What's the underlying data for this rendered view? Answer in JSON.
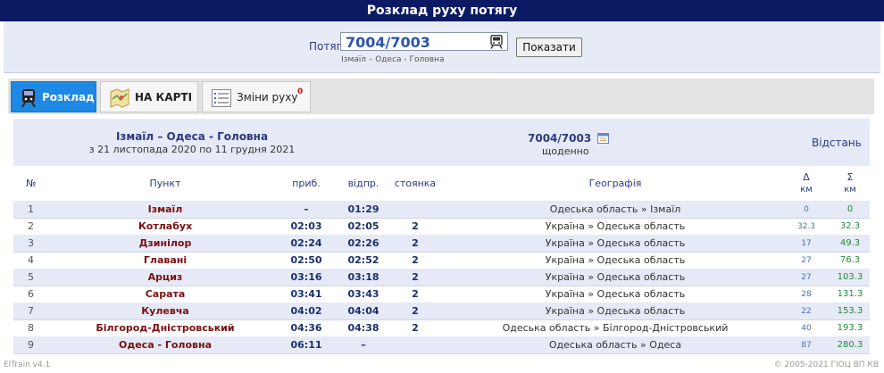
{
  "app_title": "Розклад руху потягу",
  "search": {
    "label": "Потяг",
    "value": "7004/7003",
    "hint": "Ізмаїл – Одеса - Головна",
    "button": "Показати"
  },
  "tabs": [
    {
      "label": "Розклад",
      "badge": ""
    },
    {
      "label": "НА КАРТІ",
      "badge": ""
    },
    {
      "label": "Зміни руху",
      "badge": "0"
    }
  ],
  "info": {
    "route": "Ізмаїл – Одеса - Головна",
    "dates": "з 21 листопада 2020 по 11 грудня 2021",
    "train": "7004/7003",
    "frequency": "щоденно",
    "distance_title": "Відстань"
  },
  "columns": {
    "num": "№",
    "name": "Пункт",
    "arr": "приб.",
    "dep": "відпр.",
    "stop": "стоянка",
    "geo": "Географія",
    "delta": "Δ",
    "delta_unit": "км",
    "sum": "Σ",
    "sum_unit": "км"
  },
  "stops": [
    {
      "num": "1",
      "name": "Ізмаїл",
      "arr": "–",
      "dep": "01:29",
      "stop": "",
      "geo": "Одеська область » Ізмаїл",
      "delta": "0",
      "sum": "0"
    },
    {
      "num": "2",
      "name": "Котлабух",
      "arr": "02:03",
      "dep": "02:05",
      "stop": "2",
      "geo": "Україна » Одеська область",
      "delta": "32.3",
      "sum": "32.3"
    },
    {
      "num": "3",
      "name": "Дзинілор",
      "arr": "02:24",
      "dep": "02:26",
      "stop": "2",
      "geo": "Україна » Одеська область",
      "delta": "17",
      "sum": "49.3"
    },
    {
      "num": "4",
      "name": "Главані",
      "arr": "02:50",
      "dep": "02:52",
      "stop": "2",
      "geo": "Україна » Одеська область",
      "delta": "27",
      "sum": "76.3"
    },
    {
      "num": "5",
      "name": "Арциз",
      "arr": "03:16",
      "dep": "03:18",
      "stop": "2",
      "geo": "Україна » Одеська область",
      "delta": "27",
      "sum": "103.3"
    },
    {
      "num": "6",
      "name": "Сарата",
      "arr": "03:41",
      "dep": "03:43",
      "stop": "2",
      "geo": "Україна » Одеська область",
      "delta": "28",
      "sum": "131.3"
    },
    {
      "num": "7",
      "name": "Кулевча",
      "arr": "04:02",
      "dep": "04:04",
      "stop": "2",
      "geo": "Україна » Одеська область",
      "delta": "22",
      "sum": "153.3"
    },
    {
      "num": "8",
      "name": "Білгород-Дністровський",
      "arr": "04:36",
      "dep": "04:38",
      "stop": "2",
      "geo": "Одеська область » Білгород-Дністровський",
      "delta": "40",
      "sum": "193.3"
    },
    {
      "num": "9",
      "name": "Одеса - Головна",
      "arr": "06:11",
      "dep": "–",
      "stop": "",
      "geo": "Одеська область » Одеса",
      "delta": "87",
      "sum": "280.3"
    }
  ],
  "footer": {
    "version": "ElTrain v4.1",
    "copyright": "© 2005-2021 ГІОЦ ВП КВ"
  },
  "colors": {
    "title_bar": "#0b1a63",
    "active_tab": "#1e88e5",
    "station": "#7a1010",
    "sum": "#1f8a3a"
  }
}
